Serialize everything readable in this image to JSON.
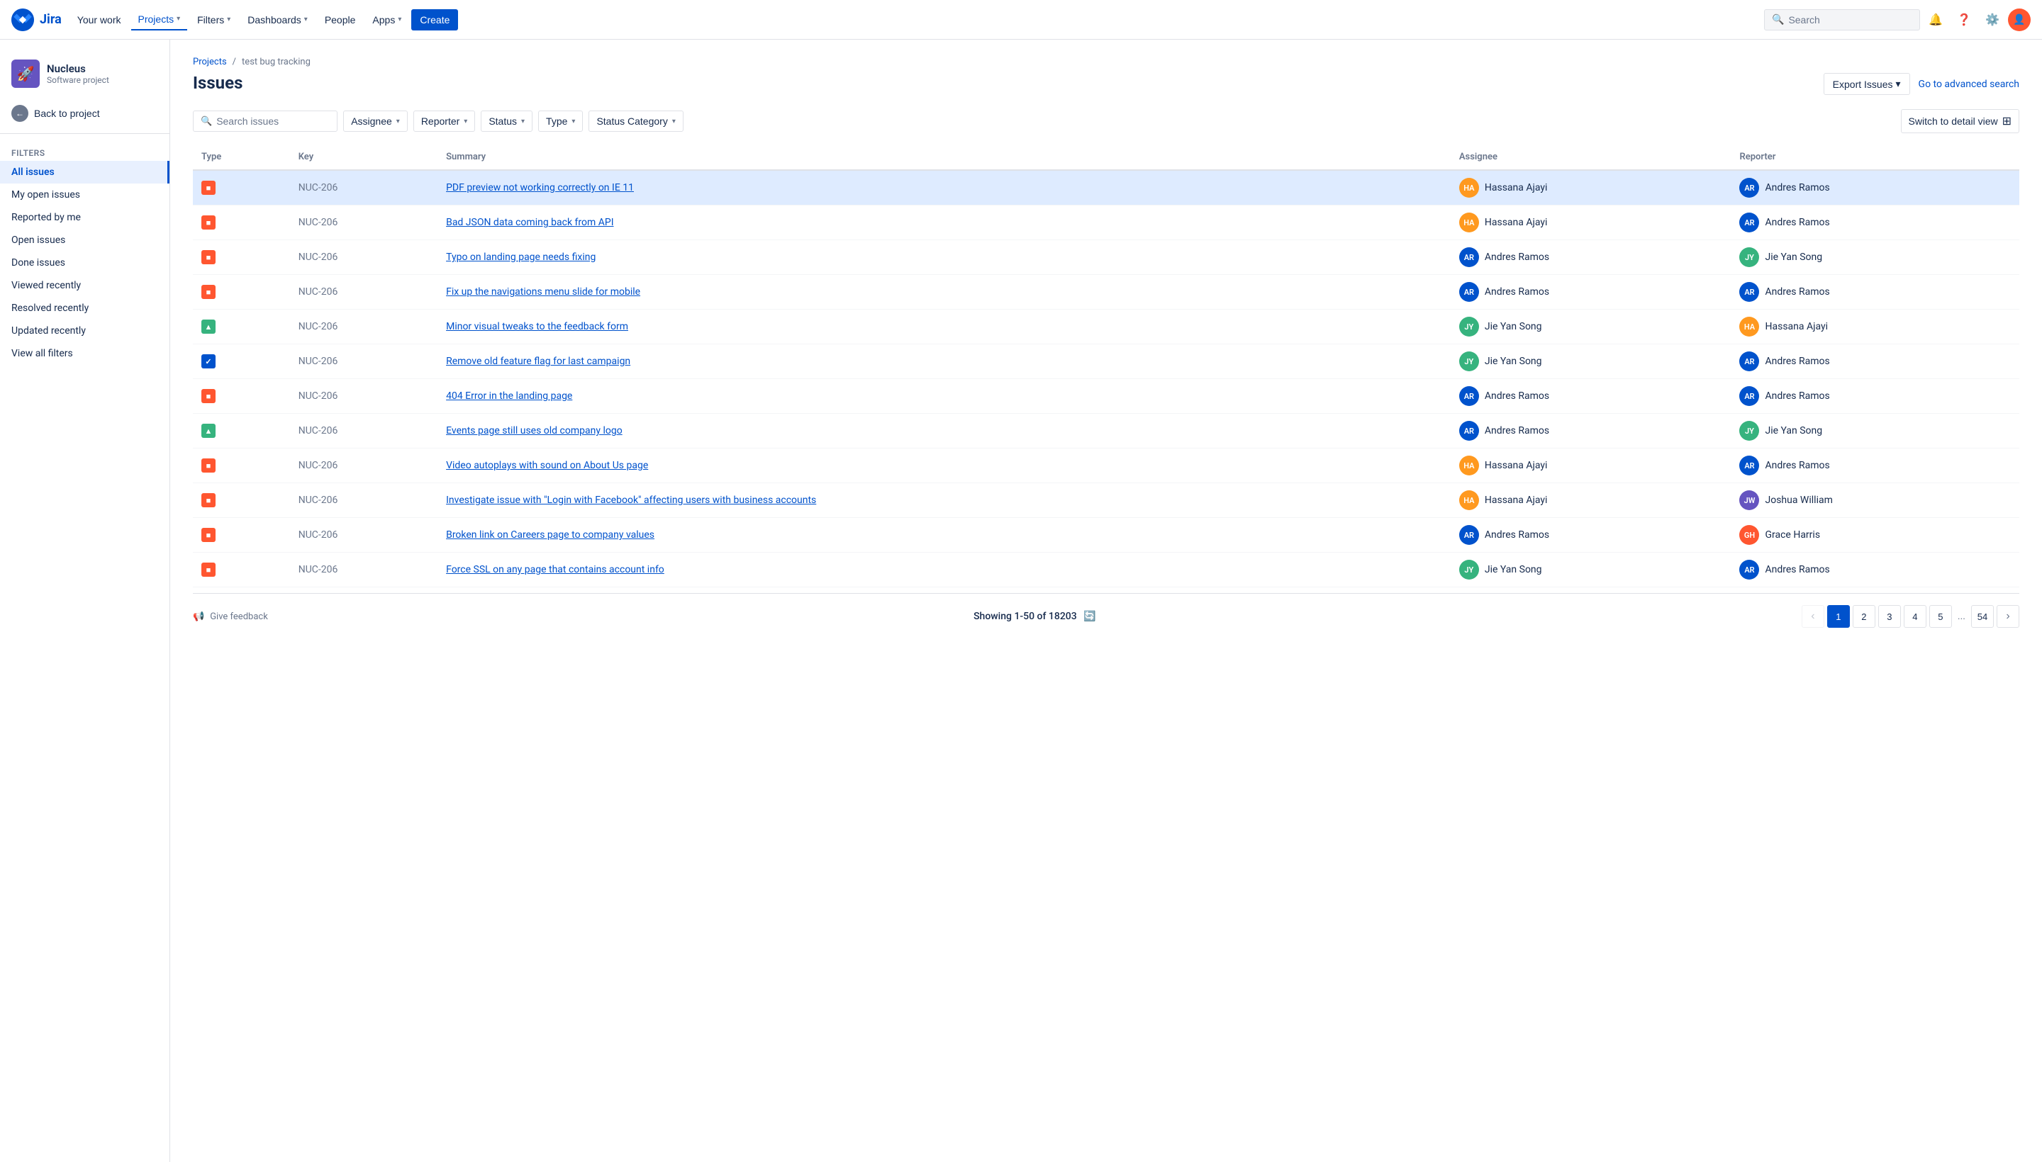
{
  "topnav": {
    "logo_text": "Jira",
    "your_work": "Your work",
    "projects": "Projects",
    "filters": "Filters",
    "dashboards": "Dashboards",
    "people": "People",
    "apps": "Apps",
    "create": "Create",
    "search_placeholder": "Search"
  },
  "sidebar": {
    "project_name": "Nucleus",
    "project_type": "Software project",
    "back_label": "Back to project",
    "section_title": "Filters",
    "items": [
      {
        "id": "all-issues",
        "label": "All issues",
        "active": true
      },
      {
        "id": "my-open-issues",
        "label": "My open issues",
        "active": false
      },
      {
        "id": "reported-by-me",
        "label": "Reported by me",
        "active": false
      },
      {
        "id": "open-issues",
        "label": "Open issues",
        "active": false
      },
      {
        "id": "done-issues",
        "label": "Done issues",
        "active": false
      },
      {
        "id": "viewed-recently",
        "label": "Viewed recently",
        "active": false
      },
      {
        "id": "resolved-recently",
        "label": "Resolved recently",
        "active": false
      },
      {
        "id": "updated-recently",
        "label": "Updated recently",
        "active": false
      }
    ],
    "view_all_filters": "View all filters"
  },
  "breadcrumb": {
    "projects_label": "Projects",
    "current_label": "test bug tracking"
  },
  "page": {
    "title": "Issues",
    "export_label": "Export Issues",
    "advanced_search_label": "Go to advanced search"
  },
  "filters": {
    "search_placeholder": "Search issues",
    "assignee": "Assignee",
    "reporter": "Reporter",
    "status": "Status",
    "type": "Type",
    "status_category": "Status Category",
    "detail_view": "Switch to detail view"
  },
  "table": {
    "columns": [
      "Type",
      "Key",
      "Summary",
      "Assignee",
      "Reporter"
    ],
    "rows": [
      {
        "type": "bug",
        "key": "NUC-206",
        "summary": "PDF preview not working correctly on IE 11",
        "assignee": "Hassana Ajayi",
        "assignee_class": "ua-hassana",
        "assignee_initials": "HA",
        "reporter": "Andres Ramos",
        "reporter_class": "ua-andres",
        "reporter_initials": "AR",
        "selected": true
      },
      {
        "type": "bug",
        "key": "NUC-206",
        "summary": "Bad JSON data coming back from API",
        "assignee": "Hassana Ajayi",
        "assignee_class": "ua-hassana",
        "assignee_initials": "HA",
        "reporter": "Andres Ramos",
        "reporter_class": "ua-andres",
        "reporter_initials": "AR",
        "selected": false
      },
      {
        "type": "bug",
        "key": "NUC-206",
        "summary": "Typo on landing page needs fixing",
        "assignee": "Andres Ramos",
        "assignee_class": "ua-andres",
        "assignee_initials": "AR",
        "reporter": "Jie Yan Song",
        "reporter_class": "ua-jie",
        "reporter_initials": "JY",
        "selected": false
      },
      {
        "type": "bug",
        "key": "NUC-206",
        "summary": "Fix up the navigations menu slide for mobile",
        "assignee": "Andres Ramos",
        "assignee_class": "ua-andres",
        "assignee_initials": "AR",
        "reporter": "Andres Ramos",
        "reporter_class": "ua-andres",
        "reporter_initials": "AR",
        "selected": false
      },
      {
        "type": "story",
        "key": "NUC-206",
        "summary": "Minor visual tweaks to the feedback form",
        "assignee": "Jie Yan Song",
        "assignee_class": "ua-jie",
        "assignee_initials": "JY",
        "reporter": "Hassana Ajayi",
        "reporter_class": "ua-hassana",
        "reporter_initials": "HA",
        "selected": false
      },
      {
        "type": "done",
        "key": "NUC-206",
        "summary": "Remove old feature flag for last campaign",
        "assignee": "Jie Yan Song",
        "assignee_class": "ua-jie",
        "assignee_initials": "JY",
        "reporter": "Andres Ramos",
        "reporter_class": "ua-andres",
        "reporter_initials": "AR",
        "selected": false
      },
      {
        "type": "bug",
        "key": "NUC-206",
        "summary": "404 Error in the landing page",
        "assignee": "Andres Ramos",
        "assignee_class": "ua-andres",
        "assignee_initials": "AR",
        "reporter": "Andres Ramos",
        "reporter_class": "ua-andres",
        "reporter_initials": "AR",
        "selected": false
      },
      {
        "type": "story",
        "key": "NUC-206",
        "summary": "Events page still uses old company logo",
        "assignee": "Andres Ramos",
        "assignee_class": "ua-andres",
        "assignee_initials": "AR",
        "reporter": "Jie Yan Song",
        "reporter_class": "ua-jie",
        "reporter_initials": "JY",
        "selected": false
      },
      {
        "type": "bug",
        "key": "NUC-206",
        "summary": "Video autoplays with sound on About Us page",
        "assignee": "Hassana Ajayi",
        "assignee_class": "ua-hassana",
        "assignee_initials": "HA",
        "reporter": "Andres Ramos",
        "reporter_class": "ua-andres",
        "reporter_initials": "AR",
        "selected": false
      },
      {
        "type": "bug",
        "key": "NUC-206",
        "summary": "Investigate issue with \"Login with Facebook\" affecting users with business accounts",
        "assignee": "Hassana Ajayi",
        "assignee_class": "ua-hassana",
        "assignee_initials": "HA",
        "reporter": "Joshua William",
        "reporter_class": "ua-joshua",
        "reporter_initials": "JW",
        "selected": false
      },
      {
        "type": "bug",
        "key": "NUC-206",
        "summary": "Broken link on Careers page to company values",
        "assignee": "Andres Ramos",
        "assignee_class": "ua-andres",
        "assignee_initials": "AR",
        "reporter": "Grace Harris",
        "reporter_class": "ua-grace",
        "reporter_initials": "GH",
        "selected": false
      },
      {
        "type": "bug",
        "key": "NUC-206",
        "summary": "Force SSL on any page that contains account info",
        "assignee": "Jie Yan Song",
        "assignee_class": "ua-jie",
        "assignee_initials": "JY",
        "reporter": "Andres Ramos",
        "reporter_class": "ua-andres",
        "reporter_initials": "AR",
        "selected": false
      }
    ]
  },
  "pagination": {
    "feedback_label": "Give feedback",
    "showing_text": "Showing 1-50 of 18203",
    "pages": [
      "1",
      "2",
      "3",
      "4",
      "5",
      "...",
      "54"
    ],
    "current_page": "1"
  }
}
